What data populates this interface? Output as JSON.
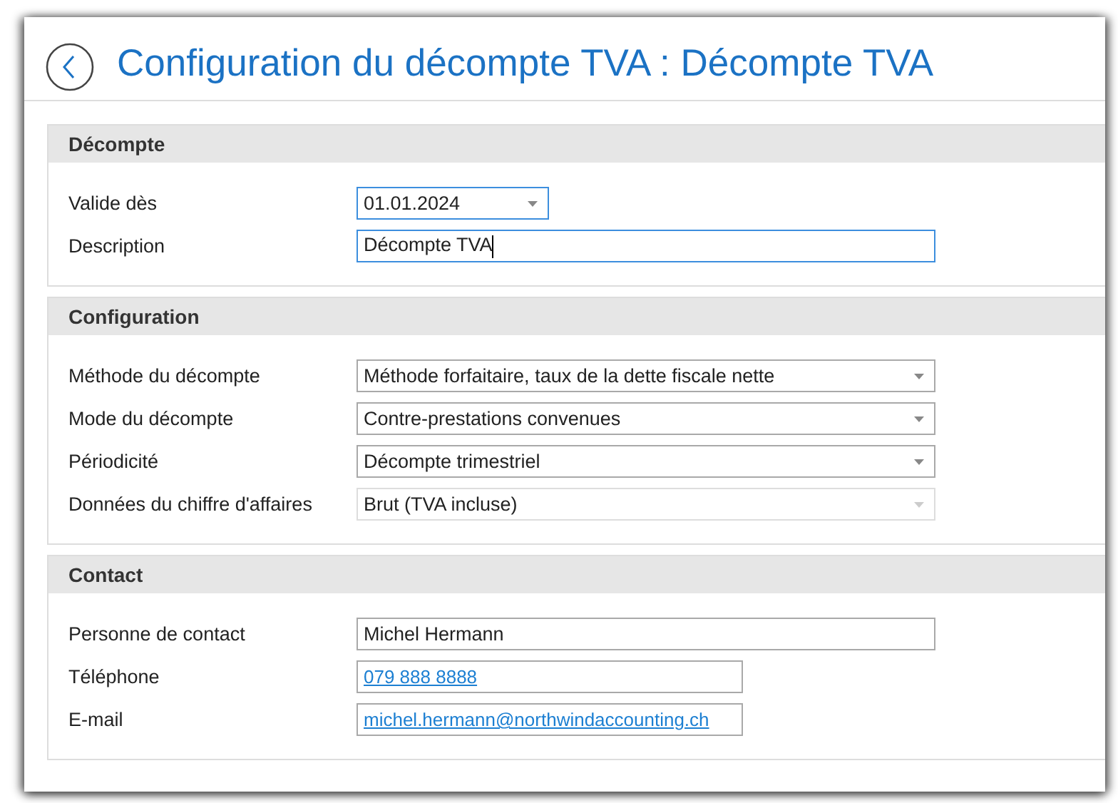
{
  "page": {
    "title": "Configuration du décompte TVA : Décompte TVA"
  },
  "sections": [
    {
      "title": "Décompte",
      "fields": [
        {
          "label": "Valide dès",
          "kind": "date",
          "value": "01.01.2024",
          "focused": true,
          "disabled": false
        },
        {
          "label": "Description",
          "kind": "text",
          "value": "Décompte TVA",
          "focused": true,
          "disabled": false
        }
      ]
    },
    {
      "title": "Configuration",
      "fields": [
        {
          "label": "Méthode du décompte",
          "kind": "dropdown",
          "value": "Méthode forfaitaire, taux de la dette fiscale nette",
          "focused": false,
          "disabled": false
        },
        {
          "label": "Mode du décompte",
          "kind": "dropdown",
          "value": "Contre-prestations convenues",
          "focused": false,
          "disabled": false
        },
        {
          "label": "Périodicité",
          "kind": "dropdown",
          "value": "Décompte trimestriel",
          "focused": false,
          "disabled": false
        },
        {
          "label": "Données du chiffre d'affaires",
          "kind": "dropdown",
          "value": "Brut (TVA incluse)",
          "focused": false,
          "disabled": true
        }
      ]
    },
    {
      "title": "Contact",
      "fields": [
        {
          "label": "Personne de contact",
          "kind": "text",
          "value": "Michel Hermann",
          "focused": false,
          "disabled": false
        },
        {
          "label": "Téléphone",
          "kind": "link",
          "value": "079 888 8888",
          "focused": false,
          "disabled": false
        },
        {
          "label": "E-mail",
          "kind": "link",
          "value": "michel.hermann@northwindaccounting.ch",
          "focused": false,
          "disabled": false
        }
      ]
    }
  ]
}
